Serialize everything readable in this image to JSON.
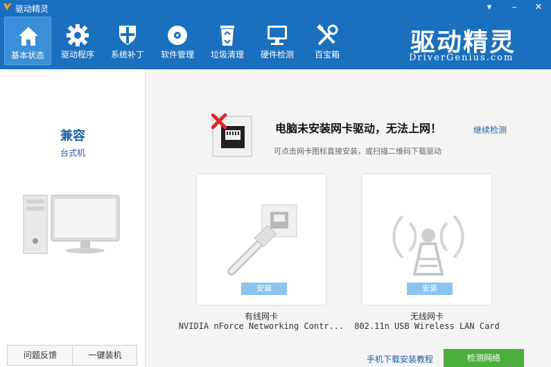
{
  "window": {
    "title": "驱动精灵",
    "controls": [
      "dropdown-icon",
      "minimize-icon",
      "close-icon"
    ]
  },
  "toolbar": {
    "items": [
      {
        "label": "基本状态",
        "icon": "home-icon",
        "active": true
      },
      {
        "label": "驱动程序",
        "icon": "gear-icon",
        "active": false
      },
      {
        "label": "系统补丁",
        "icon": "shield-icon",
        "active": false
      },
      {
        "label": "软件管理",
        "icon": "disc-icon",
        "active": false
      },
      {
        "label": "垃圾清理",
        "icon": "recycle-bin-icon",
        "active": false
      },
      {
        "label": "硬件检测",
        "icon": "monitor-icon",
        "active": false
      },
      {
        "label": "百宝箱",
        "icon": "tools-icon",
        "active": false
      }
    ],
    "brand_text": "驱动精灵",
    "brand_url": "DriverGenius.com"
  },
  "left": {
    "device_name": "兼容",
    "device_type": "台式机",
    "feedback_label": "问题反馈",
    "one_click_label": "一键装机"
  },
  "main": {
    "alert_title": "电脑未安装网卡驱动，无法上网！",
    "alert_link": "继续检测",
    "alert_sub": "可点击网卡图标直接安装，或扫描二维码下载驱动",
    "cards": [
      {
        "install_label": "安装",
        "title": "有线网卡",
        "desc": "NVIDIA nForce Networking Contr..."
      },
      {
        "install_label": "安装",
        "title": "无线网卡",
        "desc": "802.11n USB Wireless LAN Card"
      }
    ],
    "mobile_link": "手机下载安装教程",
    "detect_button": "检测网络"
  },
  "colors": {
    "titlebar": "#1a6fbf",
    "accent_link": "#1a5fa8",
    "install_button": "#8cc4ef",
    "detect_button": "#4cae3c",
    "error": "#e0262b"
  }
}
